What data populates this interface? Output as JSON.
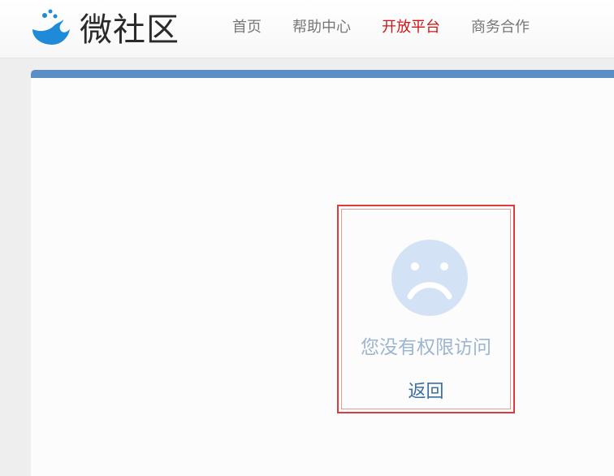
{
  "header": {
    "logo_text": "微社区",
    "nav": [
      {
        "label": "首页"
      },
      {
        "label": "帮助中心"
      },
      {
        "label": "开放平台"
      },
      {
        "label": "商务合作"
      }
    ]
  },
  "error": {
    "message": "您没有权限访问",
    "back_label": "返回"
  },
  "colors": {
    "accent_bar": "#5b8ec4",
    "active_nav": "#d11515",
    "error_border": "#e03b3b",
    "face": "#d3e3f5"
  },
  "icons": {
    "logo": "whale-icon",
    "status": "sad-face-icon"
  }
}
